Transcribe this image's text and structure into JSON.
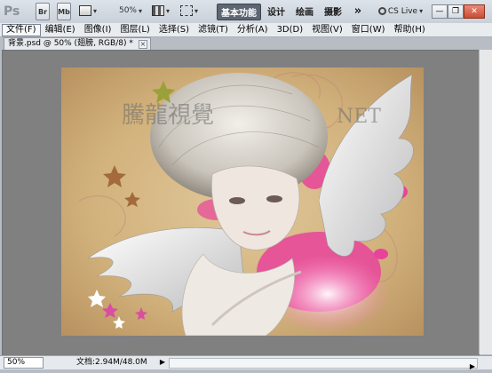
{
  "app": {
    "logo": "Ps",
    "toolbar": {
      "bridge_label": "Br",
      "minibridge_label": "Mb",
      "zoom_value": "50%",
      "workspaces": [
        "基本功能",
        "设计",
        "绘画",
        "摄影"
      ],
      "more_label": "»",
      "cslive_label": "CS Live"
    }
  },
  "menus": [
    "文件(F)",
    "编辑(E)",
    "图像(I)",
    "图层(L)",
    "选择(S)",
    "滤镜(T)",
    "分析(A)",
    "3D(D)",
    "视图(V)",
    "窗口(W)",
    "帮助(H)"
  ],
  "document": {
    "tab_title": "背景.psd @ 50% (翅膀, RGB/8) * ",
    "watermark": "騰龍視覺",
    "watermark_suffix": "NET"
  },
  "status": {
    "zoom": "50%",
    "doc_info": "文档:2.94M/48.0M"
  },
  "icons": {
    "screen_mode": "screen-mode-icon",
    "arrange": "arrange-documents-icon",
    "hand": "view-extras-icon"
  }
}
